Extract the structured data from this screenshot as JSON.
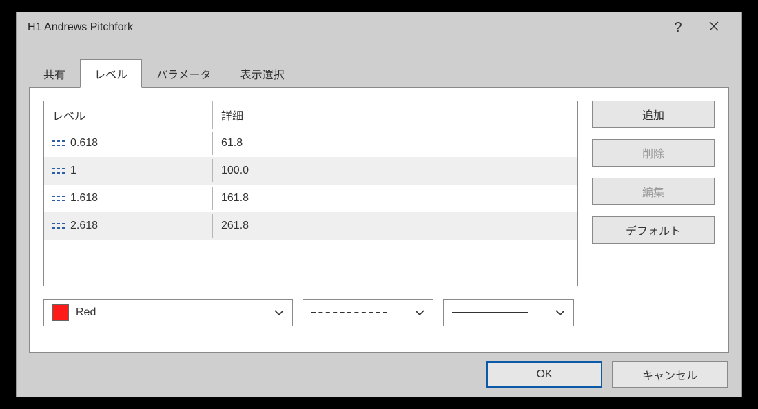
{
  "window": {
    "title": "H1 Andrews Pitchfork"
  },
  "tabs": [
    "共有",
    "レベル",
    "パラメータ",
    "表示選択"
  ],
  "activeTabIndex": 1,
  "grid": {
    "headers": {
      "level": "レベル",
      "detail": "詳細"
    },
    "rows": [
      {
        "level": "0.618",
        "detail": "61.8"
      },
      {
        "level": "1",
        "detail": "100.0"
      },
      {
        "level": "1.618",
        "detail": "161.8"
      },
      {
        "level": "2.618",
        "detail": "261.8"
      }
    ]
  },
  "colorPicker": {
    "value": "Red",
    "swatch": "#ff1a1a"
  },
  "sideButtons": {
    "add": "追加",
    "delete": "削除",
    "edit": "編集",
    "default": "デフォルト"
  },
  "footer": {
    "ok": "OK",
    "cancel": "キャンセル"
  }
}
